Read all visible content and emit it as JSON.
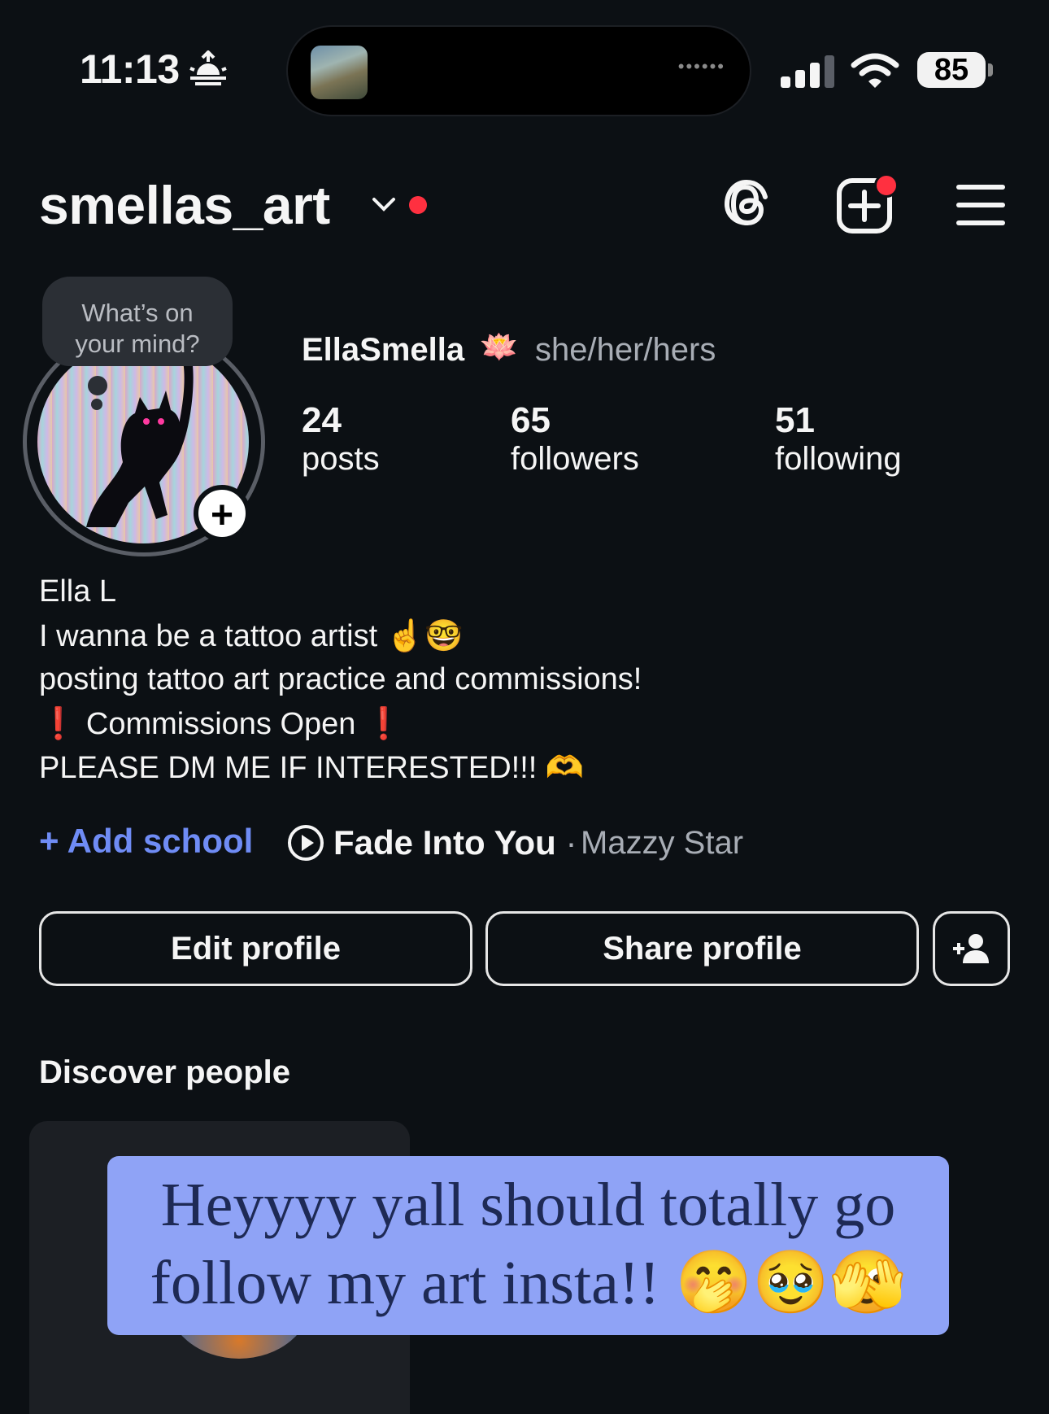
{
  "status_bar": {
    "time": "11:13",
    "battery": "85"
  },
  "header": {
    "username": "smellas_art"
  },
  "profile": {
    "note_bubble": [
      "What’s on",
      "your mind?"
    ],
    "display_name": "EllaSmella",
    "name_emoji": "🪷",
    "pronouns": "she/her/hers",
    "stats": [
      {
        "value": "24",
        "label": "posts"
      },
      {
        "value": "65",
        "label": "followers"
      },
      {
        "value": "51",
        "label": "following"
      }
    ],
    "bio": {
      "name": "Ella L",
      "line1": "I wanna be a tattoo artist",
      "line1_emoji": "☝️🤓",
      "line2": "posting tattoo art practice and commissions!",
      "line3_mark": "❗",
      "line3": "Commissions Open",
      "line4": "PLEASE DM ME IF INTERESTED!!!",
      "line4_emoji": "🫶"
    },
    "add_school": "Add school",
    "music": {
      "song": "Fade Into You",
      "separator": "·",
      "artist": "Mazzy Star"
    }
  },
  "actions": {
    "edit": "Edit profile",
    "share": "Share profile"
  },
  "discover": {
    "title": "Discover people"
  },
  "sticker": {
    "line1": "Heyyyy yall should totally go",
    "line2": "follow my art insta!!",
    "emoji": "🤭🥹🫣"
  },
  "colors": {
    "background": "#0c1014",
    "accent_blue": "#6f8cf5",
    "notification_red": "#ff3040",
    "sticker_bg": "#8fa3f6"
  },
  "icons": [
    "sunrise-icon",
    "signal-icon",
    "wifi-icon",
    "battery-icon",
    "chevron-down-icon",
    "threads-icon",
    "create-icon",
    "menu-icon",
    "play-icon",
    "add-person-icon",
    "plus-icon"
  ]
}
